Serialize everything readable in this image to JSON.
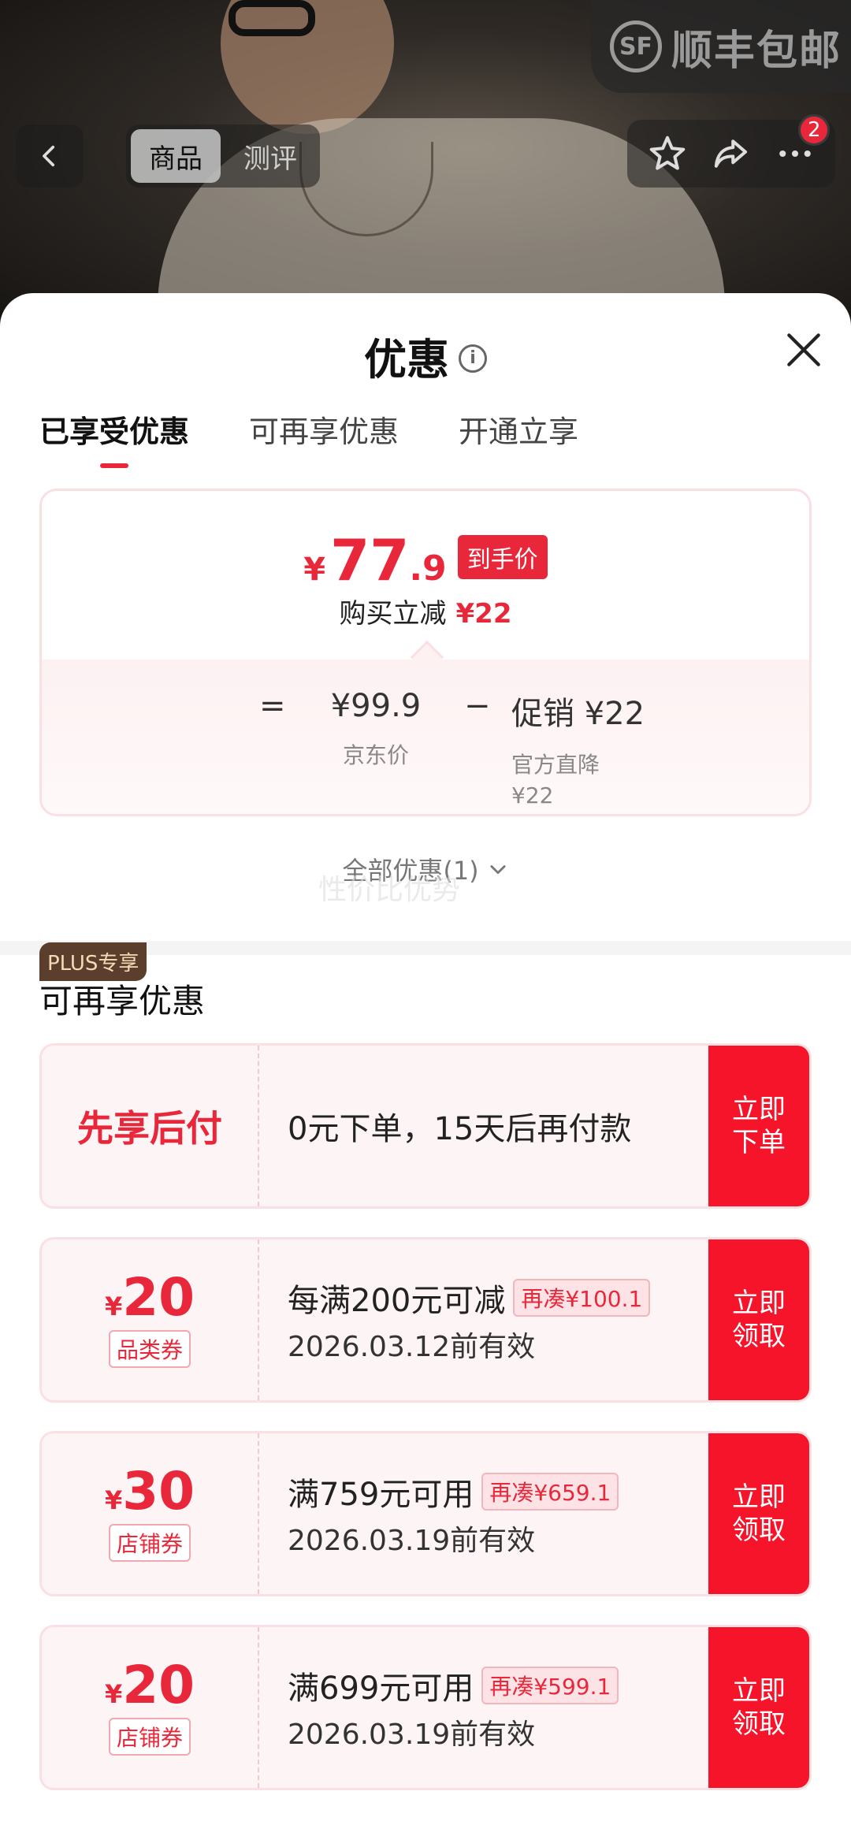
{
  "header": {
    "sf_logo": "SF",
    "sf_text": "顺丰包邮",
    "tabs": [
      "商品",
      "测评"
    ],
    "active_tab": 0,
    "message_count": "2"
  },
  "sheet": {
    "title": "优惠",
    "tabs": [
      "已享受优惠",
      "可再享优惠",
      "开通立享"
    ],
    "active_tab": 0
  },
  "price_card": {
    "yen": "¥",
    "hand_price_int": "77",
    "hand_price_dec": ".9",
    "hand_tag": "到手价",
    "buy_label": "购买立减",
    "buy_reduce": "¥22",
    "eq": "=",
    "jd_price": "¥99.9",
    "jd_label": "京东价",
    "minus": "−",
    "promo_value": "促销 ¥22",
    "promo_label": "官方直降",
    "promo_sub": "¥22"
  },
  "all_discount": "全部优惠(1)",
  "overlay_text": "性价比优势",
  "section_title": "可再享优惠",
  "bnpl": {
    "label": "先享后付",
    "desc": "0元下单，15天后再付款",
    "cta": [
      "立即",
      "下单"
    ]
  },
  "coupons": [
    {
      "plus_tag": "PLUS专享",
      "yen": "¥",
      "amount": "20",
      "type": "品类券",
      "condition": "每满200元可减",
      "extra": "再凑¥100.1",
      "expiry": "2026.03.12前有效",
      "cta": [
        "立即",
        "领取"
      ]
    },
    {
      "yen": "¥",
      "amount": "30",
      "type": "店铺券",
      "condition": "满759元可用",
      "extra": "再凑¥659.1",
      "expiry": "2026.03.19前有效",
      "cta": [
        "立即",
        "领取"
      ]
    },
    {
      "yen": "¥",
      "amount": "20",
      "type": "店铺券",
      "condition": "满699元可用",
      "extra": "再凑¥599.1",
      "expiry": "2026.03.19前有效",
      "cta": [
        "立即",
        "领取"
      ]
    }
  ],
  "colors": {
    "accent": "#e8283a",
    "cta": "#f5142a",
    "plus_tag_bg": "#5b3e2c"
  }
}
